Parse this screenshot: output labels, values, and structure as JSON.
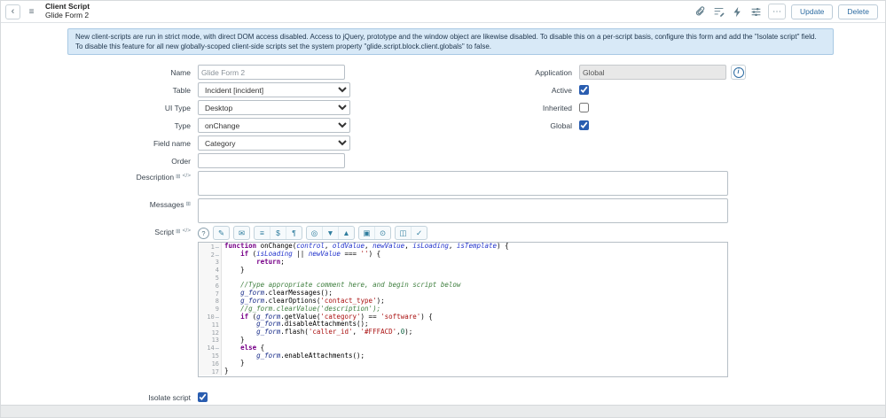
{
  "header": {
    "title": "Client Script",
    "subtitle": "Glide Form 2",
    "update": "Update",
    "delete": "Delete"
  },
  "icon_glyphs": {
    "back": "‹",
    "menu": "≡",
    "more": "⋯",
    "translate": "⊞",
    "code": "</>",
    "help": "?",
    "info": "i"
  },
  "banner": {
    "text": "New client-scripts are run in strict mode, with direct DOM access disabled. Access to jQuery, prototype and the window object are likewise disabled. To disable this on a per-script basis, configure this form and add the \"Isolate script\" field. To disable this feature for all new globally-scoped client-side scripts set the system property \"glide.script.block.client.globals\" to false."
  },
  "fields": {
    "name": {
      "label": "Name",
      "value": "Glide Form 2"
    },
    "table": {
      "label": "Table",
      "value": "Incident [incident]"
    },
    "ui_type": {
      "label": "UI Type",
      "value": "Desktop"
    },
    "type": {
      "label": "Type",
      "value": "onChange"
    },
    "field_name": {
      "label": "Field name",
      "value": "Category"
    },
    "order": {
      "label": "Order",
      "value": ""
    },
    "description": {
      "label": "Description",
      "value": ""
    },
    "messages": {
      "label": "Messages",
      "value": ""
    },
    "script": {
      "label": "Script"
    },
    "application": {
      "label": "Application",
      "value": "Global"
    },
    "active": {
      "label": "Active",
      "checked": true
    },
    "inherited": {
      "label": "Inherited",
      "checked": false
    },
    "global": {
      "label": "Global",
      "checked": true
    },
    "isolate_script": {
      "label": "Isolate script",
      "checked": true
    }
  },
  "script_editor": {
    "toolbar_groups": [
      [
        {
          "name": "format-code-button",
          "glyph": "✎"
        }
      ],
      [
        {
          "name": "comment-button",
          "glyph": "✉"
        }
      ],
      [
        {
          "name": "outline-button",
          "glyph": "≡"
        },
        {
          "name": "replace-button",
          "glyph": "$"
        },
        {
          "name": "wrap-lines-button",
          "glyph": "¶"
        }
      ],
      [
        {
          "name": "search-button",
          "glyph": "◎"
        },
        {
          "name": "search-next-button",
          "glyph": "▼"
        },
        {
          "name": "search-prev-button",
          "glyph": "▲"
        }
      ],
      [
        {
          "name": "preview-button",
          "glyph": "▣"
        },
        {
          "name": "history-button",
          "glyph": "⊙"
        }
      ],
      [
        {
          "name": "save-script-button",
          "glyph": "◫"
        },
        {
          "name": "syntax-check-button",
          "glyph": "✓"
        }
      ]
    ],
    "fold_lines": [
      1,
      2,
      10,
      14
    ],
    "lines": [
      "function onChange(control, oldValue, newValue, isLoading, isTemplate) {",
      "    if (isLoading || newValue === '') {",
      "        return;",
      "    }",
      "",
      "    //Type appropriate comment here, and begin script below",
      "    g_form.clearMessages();",
      "    g_form.clearOptions('contact_type');",
      "    //g_form.clearValue('description');",
      "    if (g_form.getValue('category') == 'software') {",
      "        g_form.disableAttachments();",
      "        g_form.flash('caller_id', '#FFFACD',0);",
      "    }",
      "    else {",
      "        g_form.enableAttachments();",
      "    }",
      "}"
    ]
  }
}
